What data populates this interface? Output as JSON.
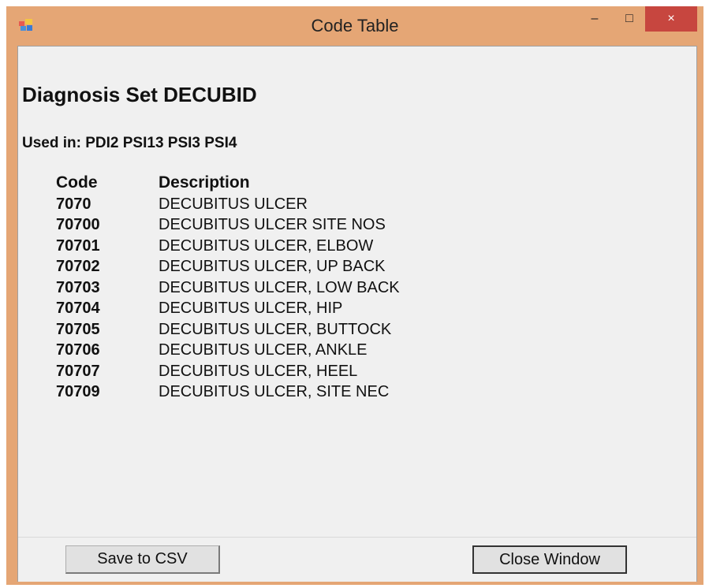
{
  "window": {
    "title": "Code Table",
    "controls": {
      "minimize": "–",
      "maximize": "□",
      "close": "×"
    }
  },
  "content": {
    "heading": "Diagnosis Set DECUBID",
    "used_in": "Used in: PDI2 PSI13 PSI3 PSI4",
    "columns": {
      "code": "Code",
      "description": "Description"
    },
    "rows": [
      {
        "code": "7070",
        "description": "DECUBITUS ULCER"
      },
      {
        "code": "70700",
        "description": "DECUBITUS ULCER SITE NOS"
      },
      {
        "code": "70701",
        "description": "DECUBITUS ULCER, ELBOW"
      },
      {
        "code": "70702",
        "description": "DECUBITUS ULCER, UP BACK"
      },
      {
        "code": "70703",
        "description": "DECUBITUS ULCER, LOW BACK"
      },
      {
        "code": "70704",
        "description": "DECUBITUS ULCER, HIP"
      },
      {
        "code": "70705",
        "description": "DECUBITUS ULCER, BUTTOCK"
      },
      {
        "code": "70706",
        "description": "DECUBITUS ULCER, ANKLE"
      },
      {
        "code": "70707",
        "description": "DECUBITUS ULCER, HEEL"
      },
      {
        "code": "70709",
        "description": "DECUBITUS ULCER, SITE NEC"
      }
    ]
  },
  "buttons": {
    "save": "Save to CSV",
    "close": "Close Window"
  },
  "colors": {
    "title_bar": "#e5a675",
    "close_button": "#c7463f",
    "client_bg": "#f0f0f0"
  }
}
